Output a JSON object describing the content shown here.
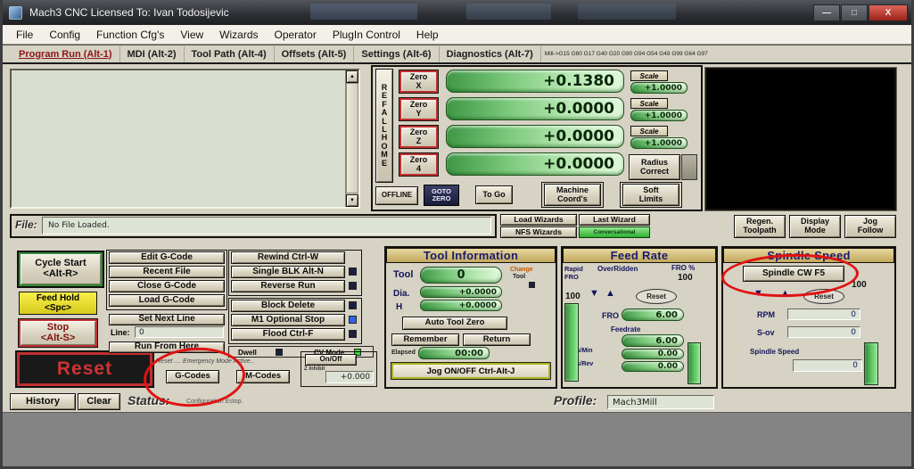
{
  "window": {
    "title": "Mach3 CNC  Licensed To: Ivan Todosijevic",
    "minimize": "—",
    "maximize": "□",
    "close": "X"
  },
  "menu": {
    "items": [
      "File",
      "Config",
      "Function Cfg's",
      "View",
      "Wizards",
      "Operator",
      "PlugIn Control",
      "Help"
    ]
  },
  "tabs": {
    "items": [
      "Program Run (Alt-1)",
      "MDI (Alt-2)",
      "Tool Path (Alt-4)",
      "Offsets (Alt-5)",
      "Settings (Alt-6)",
      "Diagnostics (Alt-7)"
    ],
    "modes": "Mill->G15 G80 G17 G40 G20 G90 G94 G54 G49 G99 G64 G97"
  },
  "axes": {
    "ref_all_home": "REF ALL HOME",
    "scale_label": "Scale",
    "radius_correct": "Radius\nCorrect",
    "rows": [
      {
        "zero": "Zero\nX",
        "value": "+0.1380",
        "scale": "+1.0000"
      },
      {
        "zero": "Zero\nY",
        "value": "+0.0000",
        "scale": "+1.0000"
      },
      {
        "zero": "Zero\nZ",
        "value": "+0.0000",
        "scale": "+1.0000"
      },
      {
        "zero": "Zero\n4",
        "value": "+0.0000"
      }
    ],
    "offline": "OFFLINE",
    "goto_zero": "GOTO\nZERO",
    "to_go": "To Go",
    "machine_coords": "Machine\nCoord's",
    "soft_limits": "Soft\nLimits"
  },
  "file_bar": {
    "label": "File:",
    "value": "No File Loaded.",
    "load_wizards": "Load Wizards",
    "nfs_wizards": "NFS Wizards",
    "last_wizard": "Last Wizard",
    "conversational": "Conversational",
    "regen_toolpath": "Regen.\nToolpath",
    "display_mode": "Display\nMode",
    "jog_follow": "Jog\nFollow"
  },
  "run": {
    "cycle_start": "Cycle Start\n<Alt-R>",
    "feed_hold": "Feed Hold\n<Spc>",
    "stop": "Stop\n<Alt-S>",
    "reset": "Reset",
    "marquee": "Reset .... Emergency Mode Active..",
    "edit_gcode": "Edit G-Code",
    "recent_file": "Recent File",
    "close_gcode": "Close G-Code",
    "load_gcode": "Load G-Code",
    "set_next_line": "Set Next Line",
    "line_label": "Line:",
    "line_value": "0",
    "run_from_here": "Run From Here",
    "rewind": "Rewind Ctrl-W",
    "single_blk": "Single BLK Alt-N",
    "reverse_run": "Reverse Run",
    "block_delete": "Block Delete",
    "m1_stop": "M1 Optional Stop",
    "flood": "Flood Ctrl-F",
    "dwell": "Dwell",
    "cv_mode": "CV Mode",
    "on_off": "On/Off",
    "g_codes": "G-Codes",
    "m_codes": "M-Codes",
    "z_inhibit": "Z Inhibit",
    "z_value": "+0.000"
  },
  "tool": {
    "title": "Tool Information",
    "tool_label": "Tool",
    "tool_value": "0",
    "change": "Change",
    "change_tool": "Tool",
    "dia_label": "Dia.",
    "dia_value": "+0.0000",
    "h_label": "H",
    "h_value": "+0.0000",
    "auto_tool_zero": "Auto Tool Zero",
    "remember": "Remember",
    "return_label": "Return",
    "elapsed_label": "Elapsed",
    "elapsed_value": "00:00",
    "jog_onoff": "Jog ON/OFF Ctrl-Alt-J"
  },
  "feed": {
    "title": "Feed Rate",
    "overridden": "OverRidden",
    "rapid_fro": "Rapid FRO",
    "fro_pct_label": "FRO %",
    "fro_pct_value": "100",
    "slider_value": "100",
    "reset": "Reset",
    "fro_label": "FRO",
    "fro_value": "6.00",
    "feedrate_label": "Feedrate",
    "feedrate_value": "6.00",
    "units_min_label": "Units/Min",
    "units_min_value": "0.00",
    "units_rev_label": "Units/Rev",
    "units_rev_value": "0.00"
  },
  "spindle": {
    "title": "Spindle Speed",
    "cw_button": "Spindle CW F5",
    "slider_value": "100",
    "reset": "Reset",
    "rpm_label": "RPM",
    "rpm_value": "0",
    "sov_label": "S-ov",
    "sov_value": "0",
    "speed_label": "Spindle Speed",
    "speed_value": "0"
  },
  "statusbar": {
    "history": "History",
    "clear": "Clear",
    "status_label": "Status:",
    "status_text": "Configuration Estop.",
    "profile_label": "Profile:",
    "profile_value": "Mach3Mill"
  },
  "icons": {
    "up": "▲",
    "down": "▼"
  },
  "colors": {
    "annotation": "#e01212",
    "dro_green": "#58c25c",
    "estop_red": "#c03030"
  }
}
